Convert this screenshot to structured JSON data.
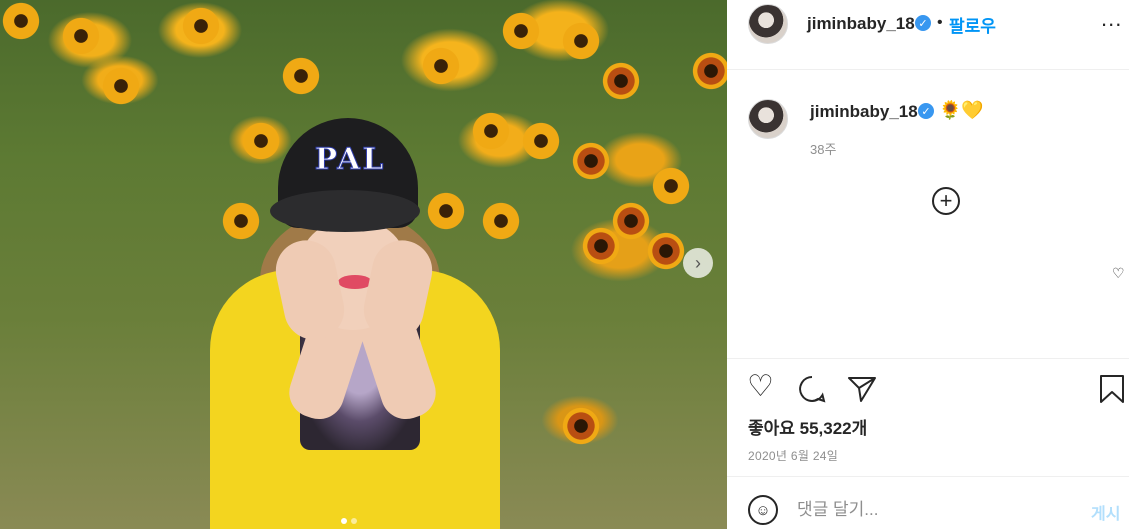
{
  "photo": {
    "cap_text": "PAL",
    "carousel": {
      "slide": 1,
      "slide_count": 2
    }
  },
  "header": {
    "username": "jiminbaby_18",
    "verified_icon": "verified-check-icon",
    "separator": "•",
    "follow_label": "팔로우",
    "more_label": "..."
  },
  "caption": {
    "username": "jiminbaby_18",
    "emojis": "🌻💛",
    "time": "38주"
  },
  "actions": {
    "like_icon": "heart-icon",
    "comment_icon": "comment-icon",
    "share_icon": "share-icon",
    "save_icon": "bookmark-icon"
  },
  "likes_text": "좋아요 55,322개",
  "date_text": "2020년 6월 24일",
  "comment": {
    "placeholder": "댓글 달기...",
    "post_label": "게시"
  },
  "colors": {
    "accent": "#0095f6",
    "post_disabled": "#b2dffc",
    "muted": "#8e8e8e"
  }
}
